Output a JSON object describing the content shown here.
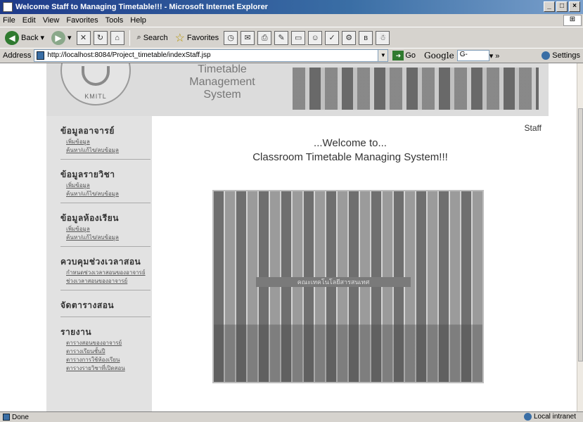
{
  "window": {
    "title": "Welcome Staff to Managing Timetable!!! - Microsoft Internet Explorer",
    "controls": [
      "_",
      "□",
      "×"
    ]
  },
  "menu": [
    "File",
    "Edit",
    "View",
    "Favorites",
    "Tools",
    "Help"
  ],
  "toolbar": {
    "back_label": "Back",
    "search_label": "Search",
    "favorites_label": "Favorites"
  },
  "address": {
    "label": "Address",
    "url": "http://localhost:8084/Project_timetable/indexStaff.jsp",
    "go_label": "Go",
    "google_label": "Google",
    "google_value": "G-",
    "settings_label": "Settings"
  },
  "header": {
    "logo_text": "KMITL",
    "title_lines": [
      "Timetable",
      "Management",
      "System"
    ]
  },
  "sidebar": {
    "groups": [
      {
        "title": "ข้อมูลอาจารย์",
        "links": [
          "เพิ่มข้อมูล",
          "ค้นหา/แก้ไข/ลบข้อมูล"
        ]
      },
      {
        "title": "ข้อมูลรายวิชา",
        "links": [
          "เพิ่มข้อมูล",
          "ค้นหา/แก้ไข/ลบข้อมูล"
        ]
      },
      {
        "title": "ข้อมูลห้องเรียน",
        "links": [
          "เพิ่มข้อมูล",
          "ค้นหา/แก้ไข/ลบข้อมูล"
        ]
      },
      {
        "title": "ควบคุมช่วงเวลาสอน",
        "links": [
          "กำหนดช่วงเวลาสอนของอาจารย์",
          "ช่วงเวลาสอนของอาจารย์"
        ]
      },
      {
        "title": "จัดตารางสอน",
        "links": []
      },
      {
        "title": "รายงาน",
        "links": [
          "ตารางสอนของอาจารย์",
          "ตารางเรียนชั้นปี",
          "ตารางการใช้ห้องเรียน",
          "ตารางรายวิชาที่เปิดสอน"
        ]
      }
    ]
  },
  "main": {
    "role": "Staff",
    "welcome_line1": "...Welcome to...",
    "welcome_line2": "Classroom Timetable Managing System!!!",
    "photo_sign": "คณะเทคโนโลยีสารสนเทศ"
  },
  "status": {
    "left": "Done",
    "zone": "Local intranet"
  }
}
